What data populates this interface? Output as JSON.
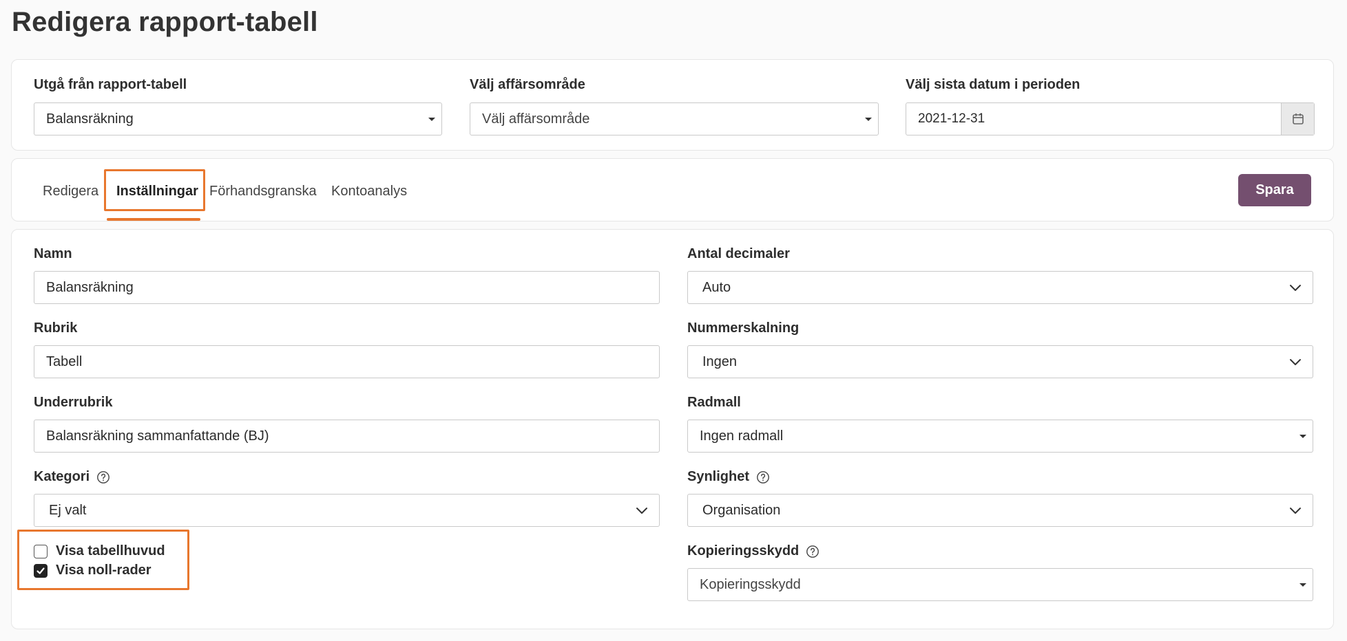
{
  "page_title": "Redigera rapport-tabell",
  "top": {
    "source_label": "Utgå från rapport-tabell",
    "source_value": "Balansräkning",
    "area_label": "Välj affärsområde",
    "area_placeholder": "Välj affärsområde",
    "date_label": "Välj sista datum i perioden",
    "date_value": "2021-12-31"
  },
  "tabs": {
    "items": [
      {
        "label": "Redigera"
      },
      {
        "label": "Inställningar"
      },
      {
        "label": "Förhandsgranska"
      },
      {
        "label": "Kontoanalys"
      }
    ],
    "active": "Inställningar",
    "save_label": "Spara"
  },
  "form": {
    "name_label": "Namn",
    "name_value": "Balansräkning",
    "heading_label": "Rubrik",
    "heading_value": "Tabell",
    "subheading_label": "Underrubrik",
    "subheading_value": "Balansräkning sammanfattande (BJ)",
    "category_label": "Kategori",
    "category_value": "Ej valt",
    "decimals_label": "Antal decimaler",
    "decimals_value": "Auto",
    "scaling_label": "Nummerskalning",
    "scaling_value": "Ingen",
    "row_template_label": "Radmall",
    "row_template_value": "Ingen radmall",
    "visibility_label": "Synlighet",
    "visibility_value": "Organisation",
    "copy_protection_label": "Kopieringsskydd",
    "copy_protection_placeholder": "Kopieringsskydd",
    "show_header_label": "Visa tabellhuvud",
    "show_header_checked": false,
    "show_zero_rows_label": "Visa noll-rader",
    "show_zero_rows_checked": true
  },
  "colors": {
    "accent_highlight": "#e8772e",
    "primary_button": "#744f6f"
  },
  "icons": {
    "help": "help-circle-icon",
    "calendar": "calendar-icon",
    "dropdown": "caret-down-icon",
    "chevron": "chevron-down-icon",
    "check": "checkmark-icon"
  }
}
